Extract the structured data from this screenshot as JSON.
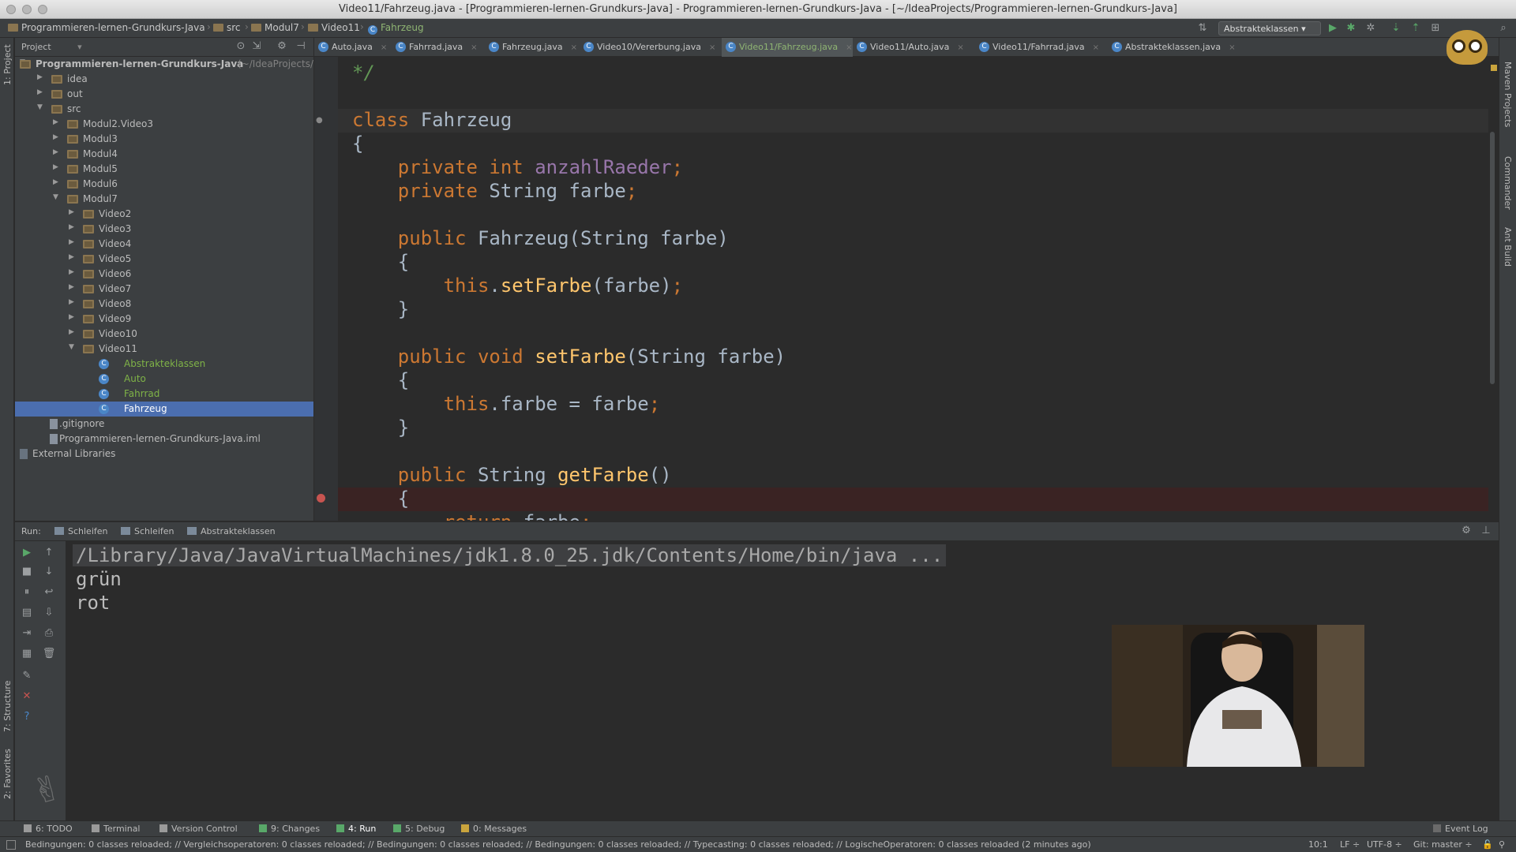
{
  "window": {
    "title": "Video11/Fahrzeug.java - [Programmieren-lernen-Grundkurs-Java] - Programmieren-lernen-Grundkurs-Java - [~/IdeaProjects/Programmieren-lernen-Grundkurs-Java]"
  },
  "breadcrumb": [
    "Programmieren-lernen-Grundkurs-Java",
    "src",
    "Modul7",
    "Video11",
    "Fahrzeug"
  ],
  "run_config": "Abstrakteklassen",
  "left_stripe": {
    "project": "1: Project",
    "structure": "7: Structure",
    "favorites": "2: Favorites"
  },
  "right_stripe": {
    "maven": "Maven Projects",
    "commander": "Commander",
    "ant": "Ant Build"
  },
  "project_panel": {
    "title": "Project",
    "root": "Programmieren-lernen-Grundkurs-Java",
    "root_path": "(~/IdeaProjects/P",
    "items": [
      {
        "label": "idea",
        "type": "folder",
        "level": 1,
        "arrow": "▶"
      },
      {
        "label": "out",
        "type": "folder",
        "level": 1,
        "arrow": "▶"
      },
      {
        "label": "src",
        "type": "folder",
        "level": 1,
        "arrow": "▼"
      },
      {
        "label": "Modul2.Video3",
        "type": "folder",
        "level": 2,
        "arrow": "▶"
      },
      {
        "label": "Modul3",
        "type": "folder",
        "level": 2,
        "arrow": "▶"
      },
      {
        "label": "Modul4",
        "type": "folder",
        "level": 2,
        "arrow": "▶"
      },
      {
        "label": "Modul5",
        "type": "folder",
        "level": 2,
        "arrow": "▶"
      },
      {
        "label": "Modul6",
        "type": "folder",
        "level": 2,
        "arrow": "▶"
      },
      {
        "label": "Modul7",
        "type": "folder",
        "level": 2,
        "arrow": "▼"
      },
      {
        "label": "Video2",
        "type": "folder",
        "level": 3,
        "arrow": "▶"
      },
      {
        "label": "Video3",
        "type": "folder",
        "level": 3,
        "arrow": "▶"
      },
      {
        "label": "Video4",
        "type": "folder",
        "level": 3,
        "arrow": "▶"
      },
      {
        "label": "Video5",
        "type": "folder",
        "level": 3,
        "arrow": "▶"
      },
      {
        "label": "Video6",
        "type": "folder",
        "level": 3,
        "arrow": "▶"
      },
      {
        "label": "Video7",
        "type": "folder",
        "level": 3,
        "arrow": "▶"
      },
      {
        "label": "Video8",
        "type": "folder",
        "level": 3,
        "arrow": "▶"
      },
      {
        "label": "Video9",
        "type": "folder",
        "level": 3,
        "arrow": "▶"
      },
      {
        "label": "Video10",
        "type": "folder",
        "level": 3,
        "arrow": "▶"
      },
      {
        "label": "Video11",
        "type": "folder",
        "level": 3,
        "arrow": "▼"
      },
      {
        "label": "Abstrakteklassen",
        "type": "class",
        "level": 4,
        "arrow": ""
      },
      {
        "label": "Auto",
        "type": "class",
        "level": 4,
        "arrow": ""
      },
      {
        "label": "Fahrrad",
        "type": "class",
        "level": 4,
        "arrow": ""
      },
      {
        "label": "Fahrzeug",
        "type": "class",
        "level": 4,
        "arrow": "",
        "selected": true
      },
      {
        "label": ".gitignore",
        "type": "file",
        "level": 1,
        "arrow": ""
      },
      {
        "label": "Programmieren-lernen-Grundkurs-Java.iml",
        "type": "file",
        "level": 1,
        "arrow": ""
      },
      {
        "label": "External Libraries",
        "type": "lib",
        "level": 0,
        "arrow": ""
      }
    ]
  },
  "tabs": [
    {
      "label": "Auto.java"
    },
    {
      "label": "Fahrrad.java"
    },
    {
      "label": "Fahrzeug.java"
    },
    {
      "label": "Video10/Vererbung.java"
    },
    {
      "label": "Video11/Fahrzeug.java",
      "active": true
    },
    {
      "label": "Video11/Auto.java"
    },
    {
      "label": "Video11/Fahrrad.java"
    },
    {
      "label": "Abstrakteklassen.java"
    }
  ],
  "code_lines": [
    "*/",
    "",
    "class Fahrzeug",
    "{",
    "    private int anzahlRaeder;",
    "    private String farbe;",
    "",
    "    public Fahrzeug(String farbe)",
    "    {",
    "        this.setFarbe(farbe);",
    "    }",
    "",
    "    public void setFarbe(String farbe)",
    "    {",
    "        this.farbe = farbe;",
    "    }",
    "",
    "    public String getFarbe()",
    "    {",
    "        return farbe;"
  ],
  "run_panel": {
    "label": "Run:",
    "tabs": [
      "Schleifen",
      "Schleifen",
      "Abstrakteklassen"
    ],
    "command": "/Library/Java/JavaVirtualMachines/jdk1.8.0_25.jdk/Contents/Home/bin/java ...",
    "output": [
      "grün",
      "rot"
    ]
  },
  "bottom_tools": [
    {
      "label": "6: TODO"
    },
    {
      "label": "Terminal"
    },
    {
      "label": "Version Control"
    },
    {
      "label": "9: Changes"
    },
    {
      "label": "4: Run",
      "active": true
    },
    {
      "label": "5: Debug"
    },
    {
      "label": "0: Messages"
    }
  ],
  "event_log": "Event Log",
  "status": {
    "message": "Bedingungen: 0 classes reloaded; // Vergleichsoperatoren: 0 classes reloaded; // Bedingungen: 0 classes reloaded; // Bedingungen: 0 classes reloaded; // Typecasting: 0 classes reloaded; // LogischeOperatoren: 0 classes reloaded (2 minutes ago)",
    "position": "10:1",
    "line_sep": "LF ÷",
    "encoding": "UTF-8 ÷",
    "vcs": "Git: master ÷"
  }
}
